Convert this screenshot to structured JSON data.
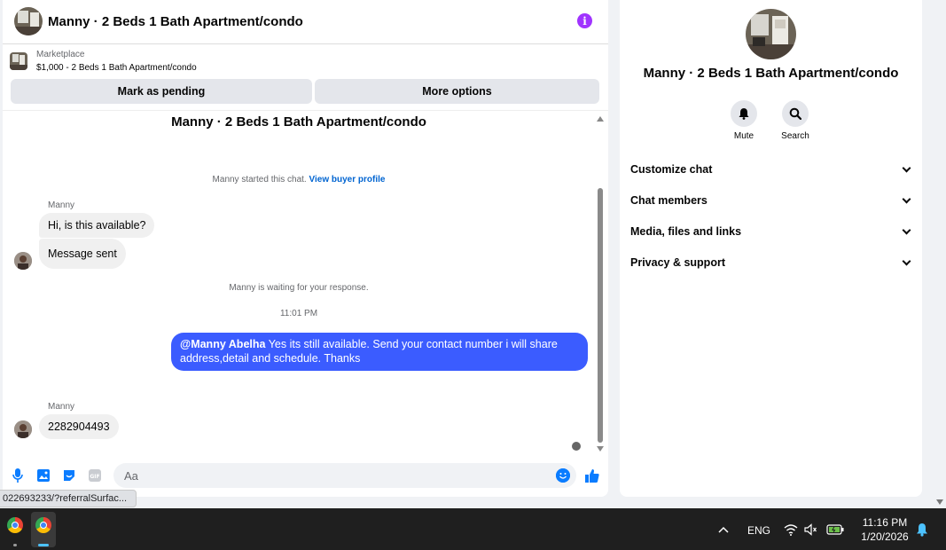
{
  "chat": {
    "title": "Manny · 2 Beds 1 Bath Apartment/condo",
    "marketplace_label": "Marketplace",
    "listing": "$1,000 - 2 Beds 1 Bath Apartment/condo",
    "btn_pending": "Mark as pending",
    "btn_more": "More options",
    "conversation_title": "Manny · 2 Beds 1 Bath Apartment/condo",
    "started_text": "Manny started this chat.",
    "view_buyer_profile": "View buyer profile",
    "messages": [
      {
        "sender": "Manny",
        "text": "Hi, is this available?"
      },
      {
        "text": "Message sent"
      },
      {
        "system": "Manny is waiting for your response."
      },
      {
        "time": "11:01 PM"
      },
      {
        "mention": "@Manny Abelha",
        "text": " Yes its still available. Send your contact number i will share address,detail and schedule. Thanks"
      },
      {
        "sender": "Manny",
        "text": "2282904493"
      }
    ],
    "composer_placeholder": "Aa"
  },
  "info_panel": {
    "name": "Manny · 2 Beds 1 Bath Apartment/condo",
    "mute_label": "Mute",
    "search_label": "Search",
    "sections": [
      "Customize chat",
      "Chat members",
      "Media, files and links",
      "Privacy & support"
    ]
  },
  "status_url": "022693233/?referralSurfac...",
  "taskbar": {
    "lang": "ENG",
    "time": "11:16 PM",
    "date": "1/20/2026"
  },
  "colors": {
    "outgoing_bubble": "#3b5cff",
    "accent": "#0a7cff",
    "info_icon": "#a033ff"
  },
  "icons": [
    "info-icon",
    "bell-icon",
    "search-icon",
    "mic-icon",
    "image-icon",
    "sticker-icon",
    "gif-icon",
    "emoji-icon",
    "thumbs-up-icon",
    "chevron-down-icon",
    "chevron-up-icon",
    "wifi-icon",
    "speaker-icon",
    "battery-icon",
    "notification-bell-icon",
    "chrome-icon"
  ]
}
